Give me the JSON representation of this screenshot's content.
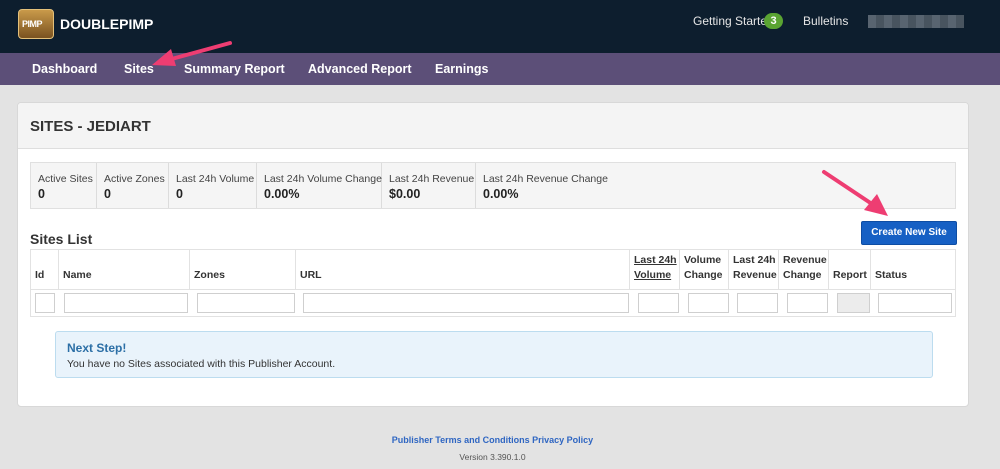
{
  "brand": {
    "name": "DOUBLEPIMP",
    "logo_text": "PIMP"
  },
  "topbar": {
    "getting_started_label": "Getting Started",
    "getting_started_count": "3",
    "bulletins_label": "Bulletins"
  },
  "nav": {
    "items": [
      {
        "label": "Dashboard"
      },
      {
        "label": "Sites"
      },
      {
        "label": "Summary Report"
      },
      {
        "label": "Advanced Report"
      },
      {
        "label": "Earnings"
      }
    ]
  },
  "page": {
    "title": "SITES - JEDIART"
  },
  "stats": [
    {
      "label": "Active Sites",
      "value": "0"
    },
    {
      "label": "Active Zones",
      "value": "0"
    },
    {
      "label": "Last 24h Volume",
      "value": "0"
    },
    {
      "label": "Last 24h Volume Change",
      "value": "0.00%"
    },
    {
      "label": "Last 24h Revenue",
      "value": "$0.00"
    },
    {
      "label": "Last 24h Revenue Change",
      "value": "0.00%"
    }
  ],
  "sites_list": {
    "title": "Sites List",
    "create_button": "Create New Site",
    "columns": [
      {
        "line1": "",
        "line2": "Id"
      },
      {
        "line1": "",
        "line2": "Name"
      },
      {
        "line1": "",
        "line2": "Zones"
      },
      {
        "line1": "",
        "line2": "URL"
      },
      {
        "line1": "Last 24h",
        "line2": "Volume"
      },
      {
        "line1": "Volume",
        "line2": "Change"
      },
      {
        "line1": "Last 24h",
        "line2": "Revenue"
      },
      {
        "line1": "Revenue",
        "line2": "Change"
      },
      {
        "line1": "",
        "line2": "Report"
      },
      {
        "line1": "",
        "line2": "Status"
      }
    ]
  },
  "alert": {
    "title": "Next Step!",
    "text": "You have no Sites associated with this Publisher Account."
  },
  "footer": {
    "links": "Publisher Terms and Conditions Privacy Policy",
    "version": "Version 3.390.1.0"
  },
  "colors": {
    "topbar_bg": "#0d1e2e",
    "navbar_bg": "#5c4f78",
    "primary_button": "#1660c4",
    "badge_green": "#5aa432",
    "annotation_arrow": "#ee3d72"
  }
}
